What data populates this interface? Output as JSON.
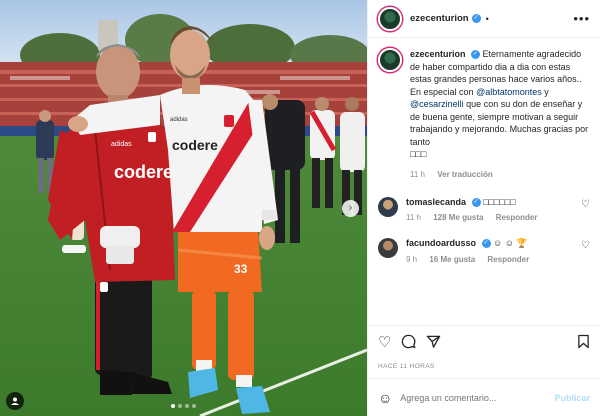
{
  "post": {
    "header": {
      "username": "ezecenturion",
      "separator": "•",
      "more": "•••"
    },
    "caption": {
      "username": "ezecenturion",
      "text_1": "Eternamente agradecido de haber compartido dia a dia con estas estas grandes personas hace varios años..",
      "text_2": "En especial con",
      "mention_1": "@albtatomontes",
      "text_3": "y",
      "mention_2": "@cesarzinelli",
      "text_4": "que con su don de enseñar y de buena gente, siempre motivan a seguir trabajando y mejorando. Muchas gracias por tanto",
      "emojis": "□□□",
      "age": "11 h",
      "translation": "Ver traducción"
    },
    "comments": [
      {
        "username": "tomaslecanda",
        "text": "□□□□□□",
        "age": "11 h",
        "likes": "128 Me gusta",
        "reply": "Responder"
      },
      {
        "username": "facundoardusso",
        "text": "☺ ☺ 🏆",
        "age": "9 h",
        "likes": "16 Me gusta",
        "reply": "Responder"
      }
    ],
    "timestamp": "HACE 11 HORAS",
    "add_comment": {
      "placeholder": "Agrega un comentario...",
      "post_label": "Publicar"
    },
    "photo": {
      "shirt_text_left": "codere",
      "shirt_text_right": "codere",
      "shirt_brand_left": "adidas",
      "shirt_brand_right": "adidas",
      "shorts_number": "33"
    }
  },
  "colors": {
    "verified": "#3897f0",
    "link": "#00376b",
    "muted": "#8e8e8e",
    "publish": "#b2dffc"
  },
  "icons": [
    "verified-icon",
    "more-icon",
    "heart-icon",
    "comment-icon",
    "share-icon",
    "bookmark-icon",
    "emoji-icon",
    "chevron-right-icon",
    "user-tag-icon"
  ]
}
